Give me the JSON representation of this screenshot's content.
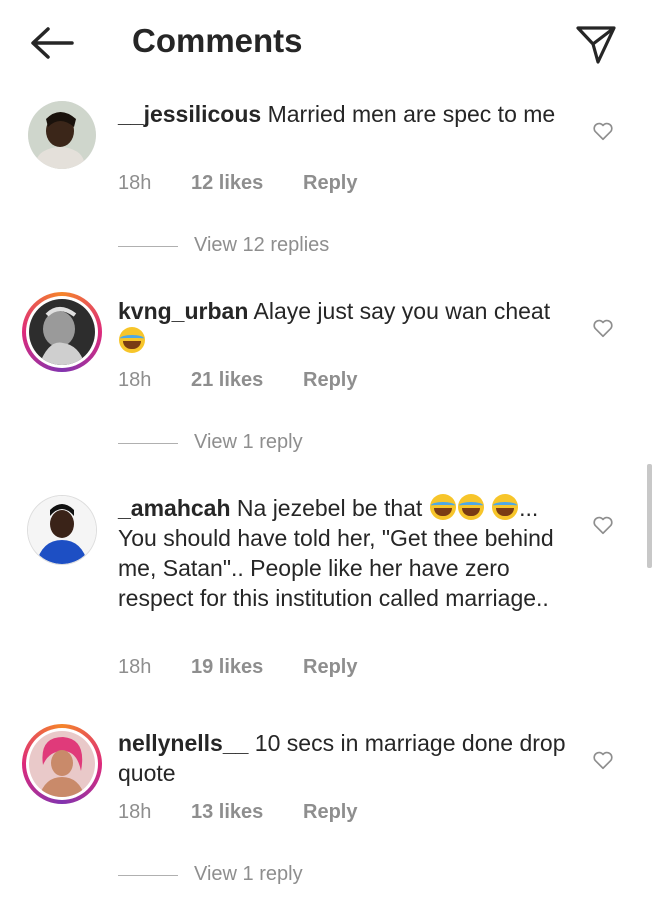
{
  "header": {
    "title": "Comments",
    "back_icon": "arrow-left-icon",
    "share_icon": "paper-plane-icon"
  },
  "colors": {
    "text": "#262626",
    "muted": "#8e8e8e",
    "story_ring": "#dd2a7b"
  },
  "comments": [
    {
      "username": "__jessilicous",
      "text": " Married men are spec to me",
      "time": "18h",
      "likes": "12 likes",
      "reply": "Reply",
      "view_replies": "View 12 replies"
    },
    {
      "username": "kvng_urban",
      "text": " Alaye just say you wan cheat ",
      "time": "18h",
      "likes": "21 likes",
      "reply": "Reply",
      "view_replies": "View 1 reply"
    },
    {
      "username": "_amahcah",
      "text": " Na jezebel be that ",
      "text2": "... You should have told her, \"Get thee behind me, Satan\".. People like her have zero respect for this institution called marriage..",
      "time": "18h",
      "likes": "19 likes",
      "reply": "Reply"
    },
    {
      "username": "nellynells__",
      "text": " 10 secs in marriage done drop quote",
      "time": "18h",
      "likes": "13 likes",
      "reply": "Reply",
      "view_replies": "View 1 reply"
    }
  ]
}
